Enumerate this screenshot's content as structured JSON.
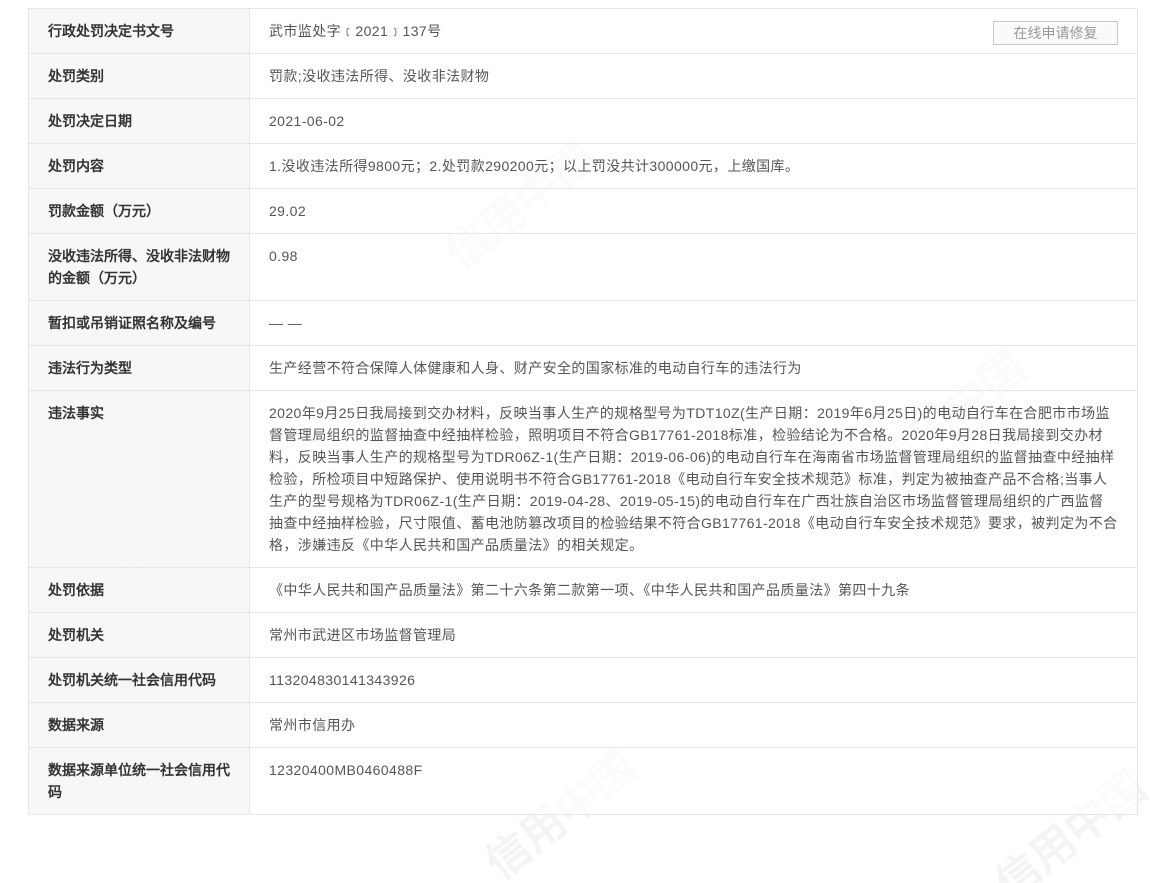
{
  "rows": [
    {
      "label": "行政处罚决定书文号",
      "value": "武市监处字﹝2021﹞137号"
    },
    {
      "label": "处罚类别",
      "value": "罚款;没收违法所得、没收非法财物"
    },
    {
      "label": "处罚决定日期",
      "value": "2021-06-02"
    },
    {
      "label": "处罚内容",
      "value": "1.没收违法所得9800元；2.处罚款290200元；以上罚没共计300000元，上缴国库。"
    },
    {
      "label": "罚款金额（万元）",
      "value": "29.02"
    },
    {
      "label": "没收违法所得、没收非法财物的金额（万元）",
      "value": "0.98"
    },
    {
      "label": "暂扣或吊销证照名称及编号",
      "value": "— —"
    },
    {
      "label": "违法行为类型",
      "value": "生产经营不符合保障人体健康和人身、财产安全的国家标准的电动自行车的违法行为"
    },
    {
      "label": "违法事实",
      "value": "2020年9月25日我局接到交办材料，反映当事人生产的规格型号为TDT10Z(生产日期：2019年6月25日)的电动自行车在合肥市市场监督管理局组织的监督抽查中经抽样检验，照明项目不符合GB17761-2018标准，检验结论为不合格。2020年9月28日我局接到交办材料，反映当事人生产的规格型号为TDR06Z-1(生产日期：2019-06-06)的电动自行车在海南省市场监督管理局组织的监督抽查中经抽样检验，所检项目中短路保护、使用说明书不符合GB17761-2018《电动自行车安全技术规范》标准，判定为被抽查产品不合格;当事人生产的型号规格为TDR06Z-1(生产日期：2019-04-28、2019-05-15)的电动自行车在广西壮族自治区市场监督管理局组织的广西监督抽查中经抽样检验，尺寸限值、蓄电池防篡改项目的检验结果不符合GB17761-2018《电动自行车安全技术规范》要求，被判定为不合格，涉嫌违反《中华人民共和国产品质量法》的相关规定。"
    },
    {
      "label": "处罚依据",
      "value": "《中华人民共和国产品质量法》第二十六条第二款第一项、《中华人民共和国产品质量法》第四十九条"
    },
    {
      "label": "处罚机关",
      "value": "常州市武进区市场监督管理局"
    },
    {
      "label": "处罚机关统一社会信用代码",
      "value": "113204830141343926"
    },
    {
      "label": "数据来源",
      "value": "常州市信用办"
    },
    {
      "label": "数据来源单位统一社会信用代码",
      "value": "12320400MB0460488F"
    }
  ],
  "repair_button": "在线申请修复",
  "watermark": "信用中国"
}
